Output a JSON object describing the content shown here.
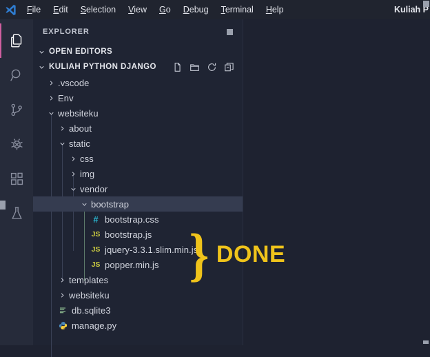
{
  "window": {
    "app_logo": "vscode-logo-icon",
    "title": "Kuliah P",
    "menu": [
      {
        "label": "File",
        "mnemonic": "F"
      },
      {
        "label": "Edit",
        "mnemonic": "E"
      },
      {
        "label": "Selection",
        "mnemonic": "S"
      },
      {
        "label": "View",
        "mnemonic": "V"
      },
      {
        "label": "Go",
        "mnemonic": "G"
      },
      {
        "label": "Debug",
        "mnemonic": "D"
      },
      {
        "label": "Terminal",
        "mnemonic": "T"
      },
      {
        "label": "Help",
        "mnemonic": "H"
      }
    ]
  },
  "activity_bar": {
    "items": [
      {
        "name": "explorer",
        "icon": "files-icon",
        "active": true
      },
      {
        "name": "search",
        "icon": "search-icon",
        "active": false
      },
      {
        "name": "source-control",
        "icon": "source-control-icon",
        "active": false
      },
      {
        "name": "run-and-debug",
        "icon": "bug-icon",
        "active": false
      },
      {
        "name": "extensions",
        "icon": "extensions-icon",
        "active": false
      },
      {
        "name": "testing",
        "icon": "beaker-icon",
        "active": false
      }
    ]
  },
  "sidebar": {
    "title": "EXPLORER",
    "more_actions_icon": "more-actions-icon",
    "sections": [
      {
        "label": "OPEN EDITORS",
        "expanded": true
      },
      {
        "label": "KULIAH PYTHON DJANGO",
        "expanded": true
      }
    ],
    "folder_actions": [
      {
        "name": "new-file",
        "icon": "new-file-icon"
      },
      {
        "name": "new-folder",
        "icon": "new-folder-icon"
      },
      {
        "name": "refresh",
        "icon": "refresh-icon"
      },
      {
        "name": "collapse-all",
        "icon": "collapse-all-icon"
      }
    ],
    "tree": [
      {
        "label": ".vscode",
        "type": "folder",
        "expanded": false,
        "depth": 1,
        "selected": false
      },
      {
        "label": "Env",
        "type": "folder",
        "expanded": false,
        "depth": 1,
        "selected": false
      },
      {
        "label": "websiteku",
        "type": "folder",
        "expanded": true,
        "depth": 1,
        "selected": false
      },
      {
        "label": "about",
        "type": "folder",
        "expanded": false,
        "depth": 2,
        "selected": false
      },
      {
        "label": "static",
        "type": "folder",
        "expanded": true,
        "depth": 2,
        "selected": false
      },
      {
        "label": "css",
        "type": "folder",
        "expanded": false,
        "depth": 3,
        "selected": false
      },
      {
        "label": "img",
        "type": "folder",
        "expanded": false,
        "depth": 3,
        "selected": false
      },
      {
        "label": "vendor",
        "type": "folder",
        "expanded": true,
        "depth": 3,
        "selected": false
      },
      {
        "label": "bootstrap",
        "type": "folder",
        "expanded": true,
        "depth": 4,
        "selected": true
      },
      {
        "label": "bootstrap.css",
        "type": "file",
        "icon": "css-file-icon",
        "badge": "#",
        "badge_color": "#29b6d0",
        "depth": 5,
        "selected": false
      },
      {
        "label": "bootstrap.js",
        "type": "file",
        "icon": "js-file-icon",
        "badge": "JS",
        "badge_color": "#cbcb41",
        "depth": 5,
        "selected": false
      },
      {
        "label": "jquery-3.3.1.slim.min.js",
        "type": "file",
        "icon": "js-file-icon",
        "badge": "JS",
        "badge_color": "#cbcb41",
        "depth": 5,
        "selected": false
      },
      {
        "label": "popper.min.js",
        "type": "file",
        "icon": "js-file-icon",
        "badge": "JS",
        "badge_color": "#cbcb41",
        "depth": 5,
        "selected": false
      },
      {
        "label": "templates",
        "type": "folder",
        "expanded": false,
        "depth": 2,
        "selected": false
      },
      {
        "label": "websiteku",
        "type": "folder",
        "expanded": false,
        "depth": 2,
        "selected": false
      },
      {
        "label": "db.sqlite3",
        "type": "file",
        "icon": "database-file-icon",
        "badge": "≡",
        "badge_color": "#7bc96f",
        "depth": 2,
        "selected": false
      },
      {
        "label": "manage.py",
        "type": "file",
        "icon": "python-file-icon",
        "badge": "◆",
        "badge_color": "#4b8bbe",
        "depth": 2,
        "selected": false
      }
    ]
  },
  "annotation": {
    "brace": "}",
    "text": "DONE",
    "color": "#efc31b"
  },
  "colors": {
    "accent": "#cf5fa0",
    "editor_background": "#1e2230",
    "sidebar_background": "#1f2433",
    "activitybar_background": "#262b3a",
    "selection": "#353c50",
    "annotation_yellow": "#efc31b"
  }
}
